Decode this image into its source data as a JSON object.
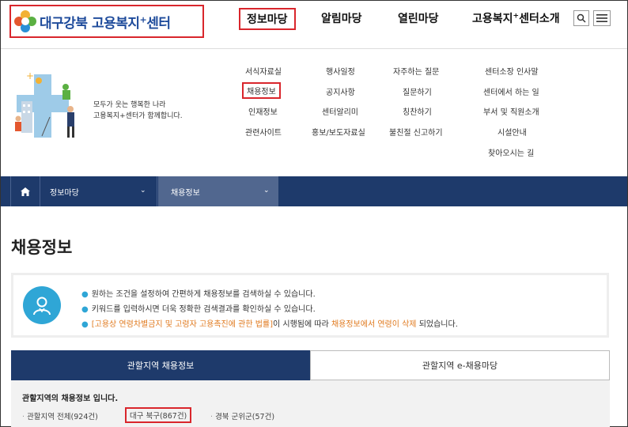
{
  "header": {
    "logo_text": "대구강북 고용복지",
    "logo_plus": "+",
    "logo_suffix": "센터",
    "nav": [
      {
        "label": "정보마당"
      },
      {
        "label": "알림마당"
      },
      {
        "label": "열린마당"
      },
      {
        "label_pre": "고용복지",
        "label_sup": "+",
        "label_post": "센터소개"
      }
    ]
  },
  "hero": {
    "tagline_1": "모두가 웃는 행복한 나라",
    "tagline_2": "고용복지+센터가 함께합니다."
  },
  "submenu": {
    "col1": [
      "서식자료실",
      "채용정보",
      "인재정보",
      "관련사이트"
    ],
    "col2": [
      "행사일정",
      "공지사항",
      "센터알리미",
      "홍보/보도자료실"
    ],
    "col3": [
      "자주하는 질문",
      "질문하기",
      "칭찬하기",
      "불친절 신고하기"
    ],
    "col4": [
      "센터소장 인사말",
      "센터에서 하는 일",
      "부서 및 직원소개",
      "시설안내",
      "찾아오시는 길"
    ]
  },
  "breadcrumb": {
    "level1": "정보마당",
    "level2": "채용정보"
  },
  "page": {
    "title": "채용정보"
  },
  "info": {
    "line1": "원하는 조건을 설정하여 간편하게 채용정보를 검색하실 수 있습니다.",
    "line2": "키워드를 입력하시면 더욱 정확한 검색결과를 확인하실 수 있습니다.",
    "line3_a": "[고용상 연령차별금지 및 고령자 고용촉진에 관한 법률]",
    "line3_b": "이 시행됨에 따라 ",
    "line3_c": "채용정보에서 연령이 삭제",
    "line3_d": " 되었습니다."
  },
  "tabs": [
    "관할지역 채용정보",
    "관할지역 e-채용마당"
  ],
  "region": {
    "title": "관할지역의 채용정보 입니다.",
    "items": [
      "관할지역 전체(924건)",
      "대구 북구(867건)",
      "경북 군위군(57건)"
    ]
  },
  "colors": {
    "navy": "#1e3a6b",
    "highlight": "#d9262c",
    "accent": "#2fa6d6",
    "warning": "#e07a1f"
  }
}
